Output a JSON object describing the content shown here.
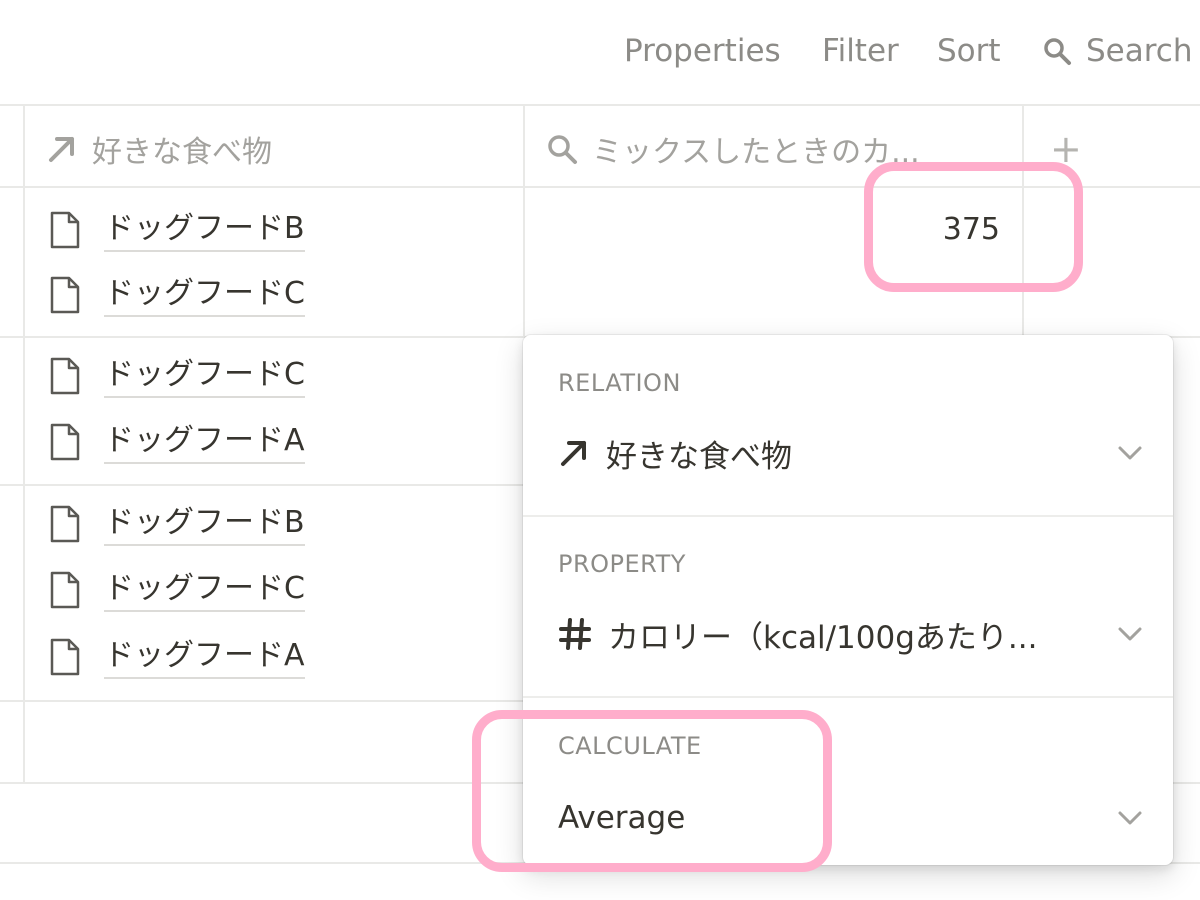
{
  "toolbar": {
    "properties": "Properties",
    "filter": "Filter",
    "sort": "Sort",
    "search": "Search",
    "search_icon": "search-icon"
  },
  "columns": {
    "relation": {
      "icon": "arrow-up-right-icon",
      "label": "好きな食べ物"
    },
    "rollup": {
      "icon": "search-icon",
      "label": "ミックスしたときのカ..."
    },
    "add": "+"
  },
  "rows": [
    {
      "items": [
        "ドッグフードB",
        "ドッグフードC"
      ],
      "rollup_value": "375"
    },
    {
      "items": [
        "ドッグフードC",
        "ドッグフードA"
      ],
      "rollup_value": ""
    },
    {
      "items": [
        "ドッグフードB",
        "ドッグフードC",
        "ドッグフードA"
      ],
      "rollup_value": ""
    }
  ],
  "popup": {
    "relation": {
      "label": "RELATION",
      "value": "好きな食べ物",
      "icon": "arrow-up-right-icon"
    },
    "property": {
      "label": "PROPERTY",
      "value": "カロリー（kcal/100gあたり...",
      "icon": "hash-icon"
    },
    "calculate": {
      "label": "CALCULATE",
      "value": "Average"
    }
  },
  "colors": {
    "highlight": "#ffadcb",
    "text": "#37352f",
    "muted": "#8c8b87",
    "border": "#e9e9e7"
  }
}
